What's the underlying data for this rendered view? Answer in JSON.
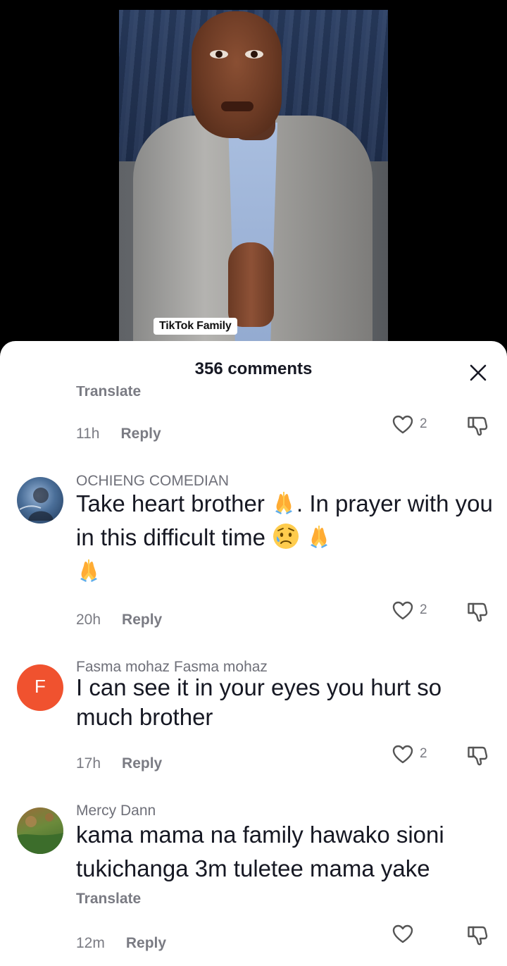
{
  "video": {
    "watermark": "TikTok Family"
  },
  "sheet": {
    "title": "356 comments"
  },
  "comments": [
    {
      "translate": "Translate",
      "time": "11h",
      "reply": "Reply",
      "likes": "2"
    },
    {
      "username": "OCHIENG COMEDIAN",
      "text_part1": "Take heart brother ",
      "text_part2": ". In prayer with you in this difficult time ",
      "time": "20h",
      "reply": "Reply",
      "likes": "2",
      "emojis": [
        "folded-hands",
        "sad-but-relieved-face",
        "folded-hands",
        "folded-hands"
      ]
    },
    {
      "username": "Fasma mohaz Fasma mohaz",
      "avatar_letter": "F",
      "avatar_color": "#f0522f",
      "text": "I can see it in your eyes you hurt so much brother",
      "time": "17h",
      "reply": "Reply",
      "likes": "2"
    },
    {
      "username": "Mercy Dann",
      "text": "kama mama na family hawako sioni tukichanga 3m tuletee mama yake",
      "translate": "Translate",
      "time": "12m",
      "reply": "Reply",
      "likes": ""
    }
  ],
  "colors": {
    "primary_text": "#161823",
    "secondary_text": "#7a7b83",
    "sheet_bg": "#ffffff"
  }
}
